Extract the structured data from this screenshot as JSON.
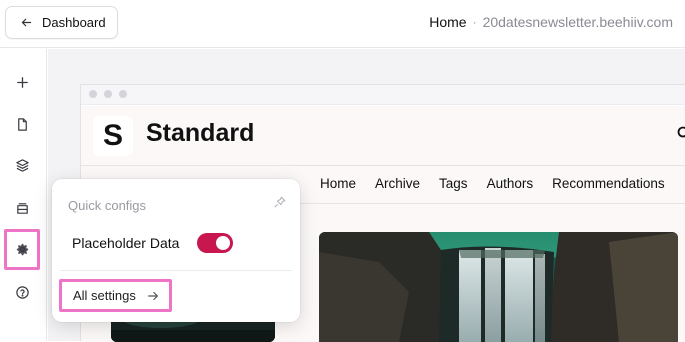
{
  "topbar": {
    "back_label": "Dashboard",
    "breadcrumb_home": "Home",
    "breadcrumb_separator": "·",
    "breadcrumb_domain": "20datesnewsletter.beehiiv.com"
  },
  "sidebar": {
    "items": [
      {
        "icon": "plus-icon"
      },
      {
        "icon": "document-icon"
      },
      {
        "icon": "layers-icon"
      },
      {
        "icon": "archive-icon"
      },
      {
        "icon": "gear-icon",
        "active": true
      },
      {
        "icon": "help-icon"
      }
    ]
  },
  "preview": {
    "logo_letter": "S",
    "site_name": "Standard",
    "nav": [
      "Home",
      "Archive",
      "Tags",
      "Authors",
      "Recommendations"
    ]
  },
  "quick_configs": {
    "title": "Quick configs",
    "toggle_label": "Placeholder Data",
    "toggle_on": true,
    "all_settings_label": "All settings"
  },
  "colors": {
    "accent": "#c8174f",
    "highlight": "#ee74c8"
  }
}
